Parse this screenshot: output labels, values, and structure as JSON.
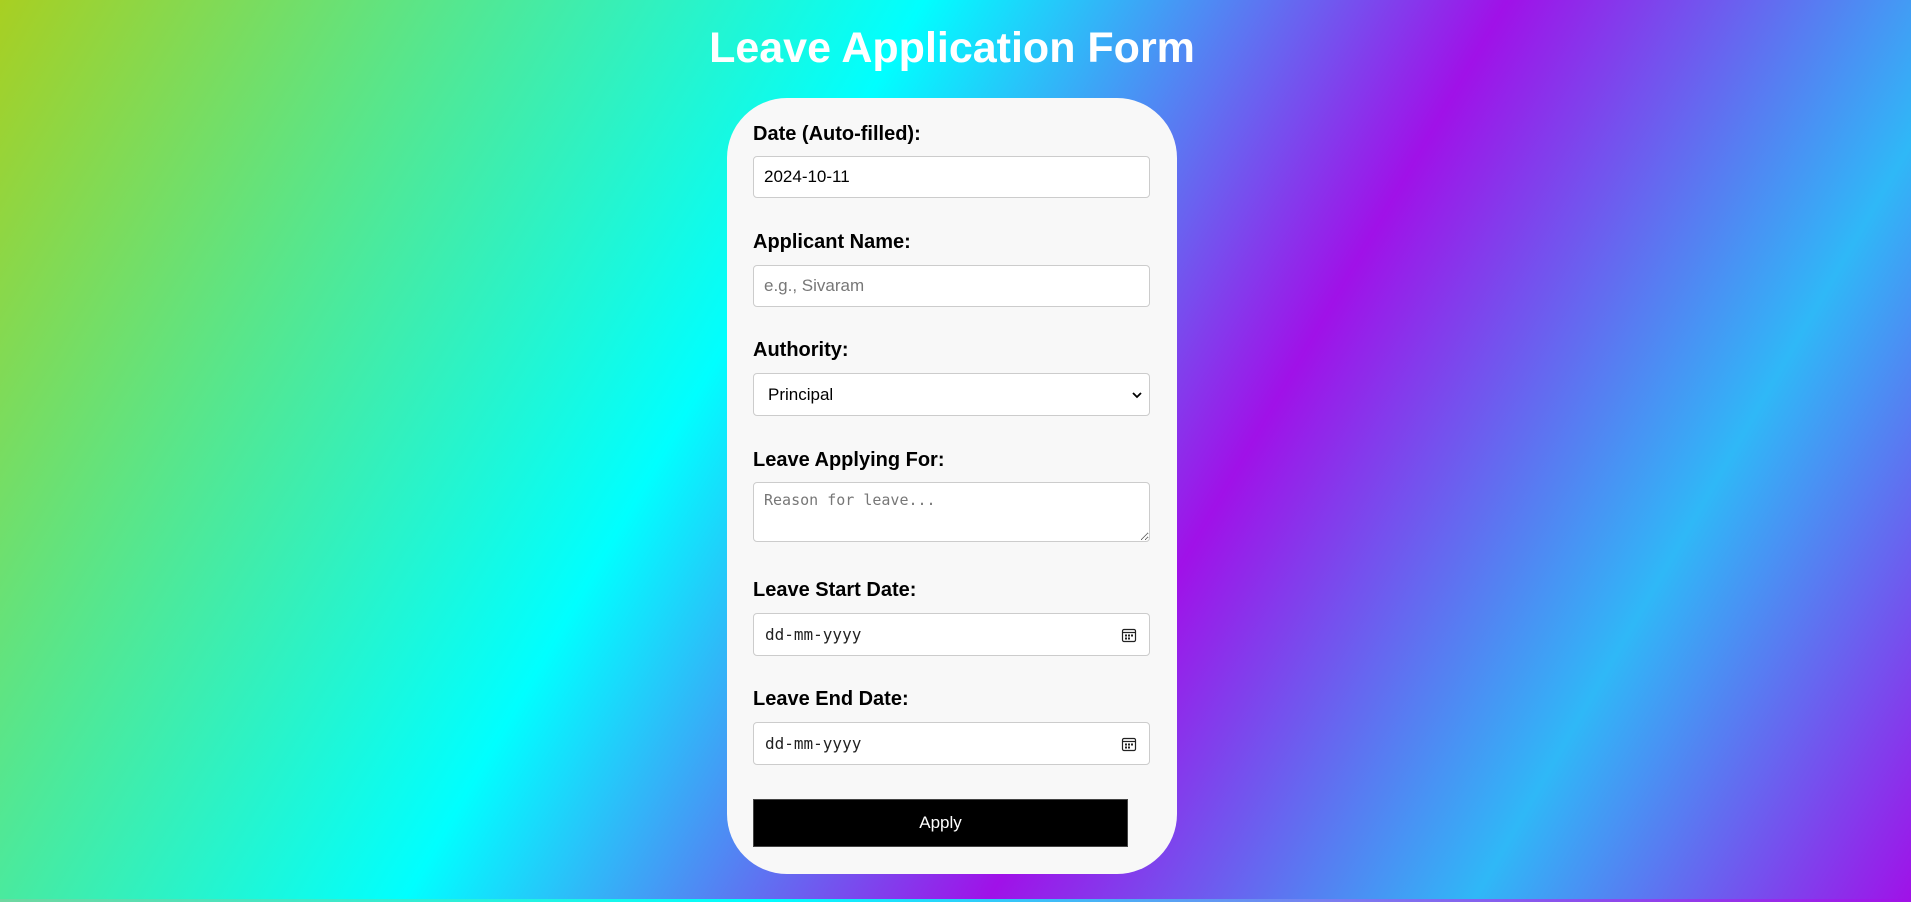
{
  "page": {
    "title": "Leave Application Form"
  },
  "form": {
    "date": {
      "label": "Date (Auto-filled):",
      "value": "2024-10-11"
    },
    "applicant_name": {
      "label": "Applicant Name:",
      "placeholder": "e.g., Sivaram",
      "value": ""
    },
    "authority": {
      "label": "Authority:",
      "selected": "Principal"
    },
    "reason": {
      "label": "Leave Applying For:",
      "placeholder": "Reason for leave..."
    },
    "start_date": {
      "label": "Leave Start Date:",
      "placeholder": "dd-mm-yyyy",
      "icon": "calendar-icon"
    },
    "end_date": {
      "label": "Leave End Date:",
      "placeholder": "dd-mm-yyyy",
      "icon": "calendar-icon"
    },
    "submit_label": "Apply"
  },
  "colors": {
    "card_background": "#f8f8f8",
    "button_background": "#000000",
    "button_text": "#ffffff",
    "title_text": "#ffffff"
  }
}
